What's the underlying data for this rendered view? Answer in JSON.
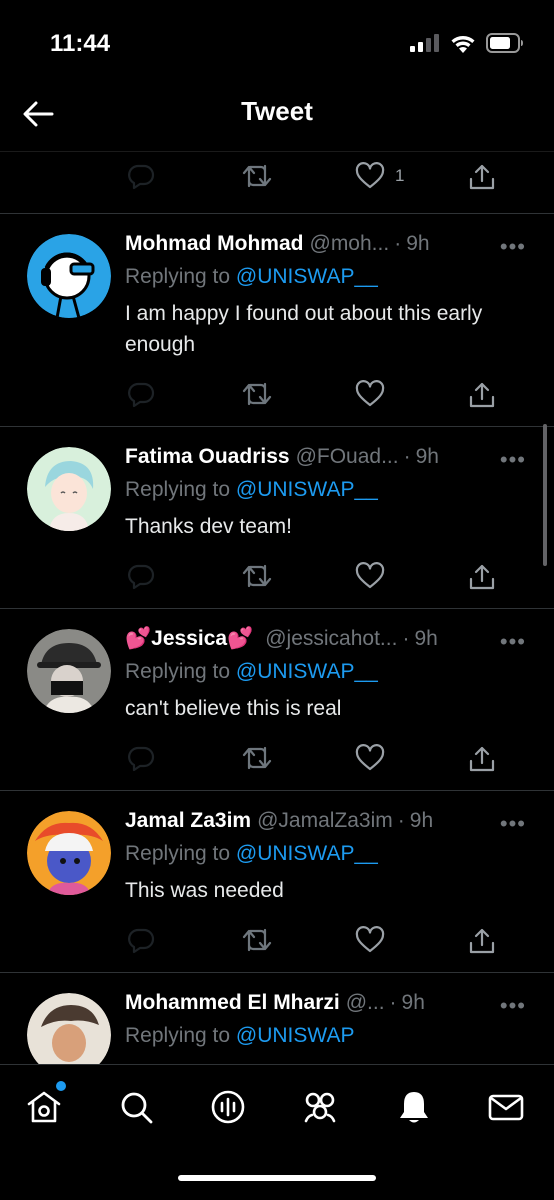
{
  "status_bar": {
    "time": "11:44"
  },
  "nav": {
    "title": "Tweet"
  },
  "top_actions": {
    "like_count": "1"
  },
  "replies": [
    {
      "name": "Mohmad Mohmad",
      "handle": "@moh...",
      "time": "9h",
      "replying_prefix": "Replying to",
      "mention": "@UNISWAP__",
      "text": "I am happy I found out about this early enough"
    },
    {
      "name": "Fatima Ouadriss",
      "handle": "@FOuad...",
      "time": "9h",
      "replying_prefix": "Replying to",
      "mention": "@UNISWAP__",
      "text": "Thanks dev team!"
    },
    {
      "name": "💕Jessica💕",
      "handle": "@jessicahot...",
      "time": "9h",
      "replying_prefix": "Replying to",
      "mention": "@UNISWAP__",
      "text": "can't believe this is real"
    },
    {
      "name": "Jamal Za3im",
      "handle": "@JamalZa3im",
      "time": "9h",
      "replying_prefix": "Replying to",
      "mention": "@UNISWAP__",
      "text": "This was needed"
    },
    {
      "name": "Mohammed El Mharzi",
      "handle": "@...",
      "time": "9h",
      "replying_prefix": "Replying to",
      "mention": "@UNISWAP",
      "text": ""
    }
  ],
  "dot_separator": "·",
  "more_glyph": "•••",
  "tabs": [
    "home-icon",
    "search-icon",
    "spaces-icon",
    "communities-icon",
    "notifications-icon",
    "messages-icon"
  ],
  "colors": {
    "accent": "#1d9bf0",
    "secondary_text": "#71767b",
    "background": "#000000"
  }
}
